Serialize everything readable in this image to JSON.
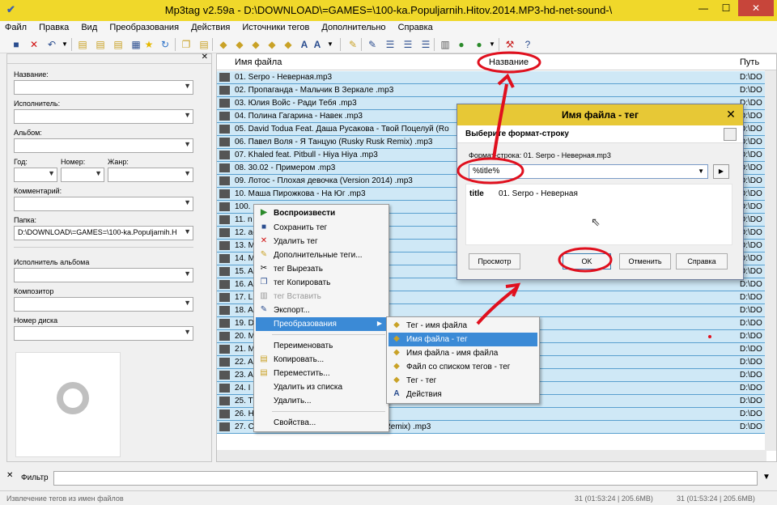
{
  "window": {
    "title": "Mp3tag v2.59a  -  D:\\DOWNLOAD\\=GAMES=\\100-ka.Populjarnih.Hitov.2014.MP3-hd-net-sound-\\",
    "minimize": "—",
    "maximize": "☐",
    "close": "✕"
  },
  "menu": [
    "Файл",
    "Правка",
    "Вид",
    "Преобразования",
    "Действия",
    "Источники тегов",
    "Дополнительно",
    "Справка"
  ],
  "left_panel": {
    "title_label": "Название:",
    "artist_label": "Исполнитель:",
    "album_label": "Альбом:",
    "year_label": "Год:",
    "track_label": "Номер:",
    "genre_label": "Жанр:",
    "comment_label": "Комментарий:",
    "folder_label": "Папка:",
    "folder_value": "D:\\DOWNLOAD\\=GAMES=\\100-ka.Populjarnih.H",
    "album_artist_label": "Исполнитель альбома",
    "composer_label": "Композитор",
    "disc_label": "Номер диска"
  },
  "list": {
    "col_filename": "Имя файла",
    "col_title": "Название",
    "col_path": "Путь",
    "rows": [
      {
        "name": "01.  Serpo - Неверная.mp3",
        "path": "D:\\DO"
      },
      {
        "name": "02.  Пропаганда - Мальчик В Зеркале .mp3",
        "path": "D:\\DO"
      },
      {
        "name": "03.  Юлия Войс - Ради Тебя .mp3",
        "path": "D:\\DO"
      },
      {
        "name": "04.  Полина Гагарина - Навек .mp3",
        "path": "D:\\DO"
      },
      {
        "name": "05.  David Todua Feat. Даша Русакова - Твой Поцелуй (Ro",
        "path": "D:\\DO"
      },
      {
        "name": "06.  Павел Воля - Я Танцую (Rusky Rusk Remix) .mp3",
        "path": "D:\\DO"
      },
      {
        "name": "07.  Khaled feat. Pitbull - Hiya Hiya .mp3",
        "path": "D:\\DO"
      },
      {
        "name": "08.  30.02 - Примером .mp3",
        "path": "D:\\DO"
      },
      {
        "name": "09.  Лотос - Плохая девочка (Version 2014) .mp3",
        "path": "D:\\DO"
      },
      {
        "name": "10.  Маша Пирожкова - На Юг .mp3",
        "path": "D:\\DO"
      },
      {
        "name": "100.",
        "path": "D:\\DO"
      },
      {
        "name": "11.                                        n Radio Remix) .mp3",
        "path": "D:\\DO"
      },
      {
        "name": "12.                                        астье .mp3",
        "path": "D:\\DO"
      },
      {
        "name": "13. M                                      o Burn & Jen Mo",
        "path": "D:\\DO"
      },
      {
        "name": "14. M",
        "path": "D:\\DO"
      },
      {
        "name": "15. A                                      ) .mp3",
        "path": "D:\\DO"
      },
      {
        "name": "16. A",
        "path": "D:\\DO"
      },
      {
        "name": "17. L                                      er. Макс Корж) .mp3",
        "path": "D:\\DO"
      },
      {
        "name": "18. A",
        "path": "D:\\DO"
      },
      {
        "name": "19. D",
        "path": "D:\\DO"
      },
      {
        "name": "20. M",
        "path": "D:\\DO"
      },
      {
        "name": "21. M",
        "path": "D:\\DO"
      },
      {
        "name": "22. A",
        "path": "D:\\DO"
      },
      {
        "name": "23. A",
        "path": "D:\\DO"
      },
      {
        "name": "24. I",
        "path": "D:\\DO"
      },
      {
        "name": "25. T                                      arty .mp3",
        "path": "D:\\DO"
      },
      {
        "name": "26. H",
        "path": "D:\\DO"
      },
      {
        "name": "27.  Светлана Лобода - Под Лед (Official Remix) .mp3",
        "path": "D:\\DO"
      }
    ]
  },
  "context_menu": {
    "play": "Воспроизвести",
    "save_tag": "Сохранить тег",
    "remove_tag": "Удалить тег",
    "extended_tags": "Дополнительные теги...",
    "cut_tag": "тег Вырезать",
    "copy_tag": "тег Копировать",
    "paste_tag": "тег Вставить",
    "export": "Экспорт...",
    "convert": "Преобразования",
    "rename": "Переименовать",
    "copy": "Копировать...",
    "move": "Переместить...",
    "remove_from_list": "Удалить из списка",
    "delete": "Удалить...",
    "properties": "Свойства..."
  },
  "submenu": {
    "tag_filename": "Тег - имя файла",
    "filename_tag": "Имя файла - тег",
    "filename_filename": "Имя файла - имя файла",
    "textfile_tag": "Файл со списком тегов - тег",
    "tag_tag": "Тег - тег",
    "actions": "Действия"
  },
  "dialog": {
    "title": "Имя файла - тег",
    "close": "✕",
    "band_title": "Выберите формат-строку",
    "format_label": "Формат-строка: 01.  Serpo - Неверная.mp3",
    "format_value": "%title%",
    "arrow_btn": "▶",
    "preview_key": "title",
    "preview_value": "01.  Serpo - Неверная",
    "preview_btn": "Просмотр",
    "ok_btn": "OK",
    "cancel_btn": "Отменить",
    "help_btn": "Справка"
  },
  "filter": {
    "label": "Фильтр"
  },
  "statusbar": {
    "left": "Извлечение тегов из имен файлов",
    "right1": "31 (01:53:24 | 205.6MB)",
    "right2": "31 (01:53:24 | 205.6MB)"
  },
  "colors": {
    "titlebar": "#f0d82a",
    "selection": "#cfe8f6",
    "annotation": "#e0101e"
  }
}
